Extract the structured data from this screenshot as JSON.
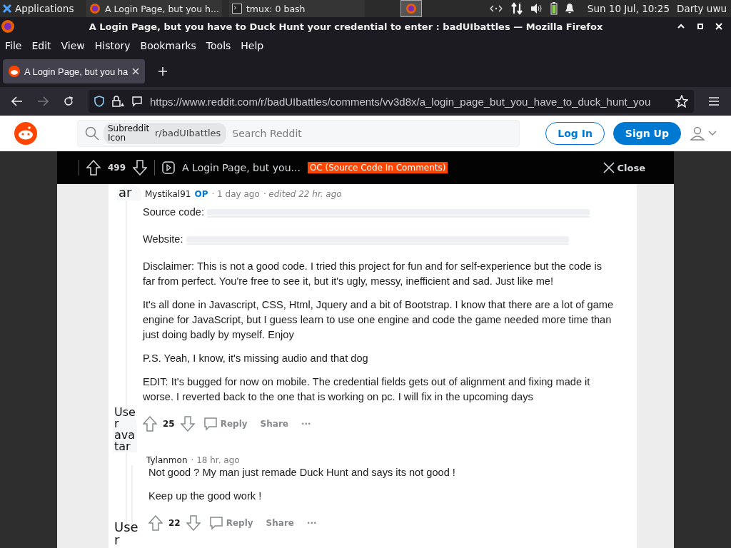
{
  "panel": {
    "apps_label": "Applications",
    "tasks": [
      {
        "label": "A Login Page, but you h...",
        "selected": false
      },
      {
        "label": "tmux: 0 bash",
        "selected": false
      }
    ],
    "clock": "Sun 10 Jul, 10:25",
    "user": "Darty uwu"
  },
  "window": {
    "title": "A Login Page, but you have to Duck Hunt your credential to enter : badUIbattles — Mozilla Firefox"
  },
  "menu": [
    "File",
    "Edit",
    "View",
    "History",
    "Bookmarks",
    "Tools",
    "Help"
  ],
  "tabs": [
    {
      "label": "A Login Page, but you ha",
      "selected": true
    }
  ],
  "address": {
    "url": "https://www.reddit.com/r/badUIbattles/comments/vv3d8x/a_login_page_but_you_have_to_duck_hunt_you"
  },
  "header": {
    "chip_alt": "Subreddit Icon",
    "chip_label": "r/badUIbattles",
    "placeholder": "Search Reddit",
    "buttons": [
      "Log In",
      "Sign Up"
    ]
  },
  "post_bar": {
    "votes": "499",
    "title": "A Login Page, but you...",
    "flair": "OC (Source Code In Comments)",
    "close": "Close"
  },
  "comments": [
    {
      "avatar_alt": "ar",
      "author": "Mystikal91",
      "op_badge": "OP",
      "time": "· 1 day ago",
      "edited": "· edited 22 hr. ago",
      "paragraphs": [
        {
          "kind": "link",
          "label": "Source code:"
        },
        {
          "kind": "link",
          "label": "Website:"
        },
        {
          "kind": "text",
          "text": "Disclaimer: This is not a good code. I tried this project for fun and for self-experience but the code is far from perfect. You're free to see it, but it's ugly, messy, inefficient and sad. Just like me!"
        },
        {
          "kind": "text",
          "text": "It's all done in Javascript, CSS, Html, Jquery and a bit of Bootstrap. I know that there are a lot of game engine for JavaScript, but I guess learn to use one engine and code the game needed more time than just doing badly by myself. Enjoy"
        },
        {
          "kind": "text",
          "text": "P.S. Yeah, I know, it's missing audio and that dog"
        },
        {
          "kind": "text",
          "text": "EDIT: It's bugged for now on mobile. The credential fields gets out of alignment and fixing made it worse. I reverted back to the one that is working on pc. I will fix in the upcoming days"
        }
      ],
      "score": "25",
      "actions": [
        "Reply",
        "Share",
        "···"
      ],
      "children": [
        {
          "avatar_alt": "User avatar",
          "author": "Tylanmon",
          "time": "· 18 hr. ago",
          "paragraphs": [
            {
              "kind": "text",
              "text": "Not good ? My man just remade Duck Hunt and says its not good !"
            },
            {
              "kind": "text",
              "text": "Keep up the good work !"
            }
          ],
          "score": "22",
          "actions": [
            "Reply",
            "Share",
            "···"
          ]
        }
      ]
    }
  ],
  "next_avatar_alt": "Use r"
}
